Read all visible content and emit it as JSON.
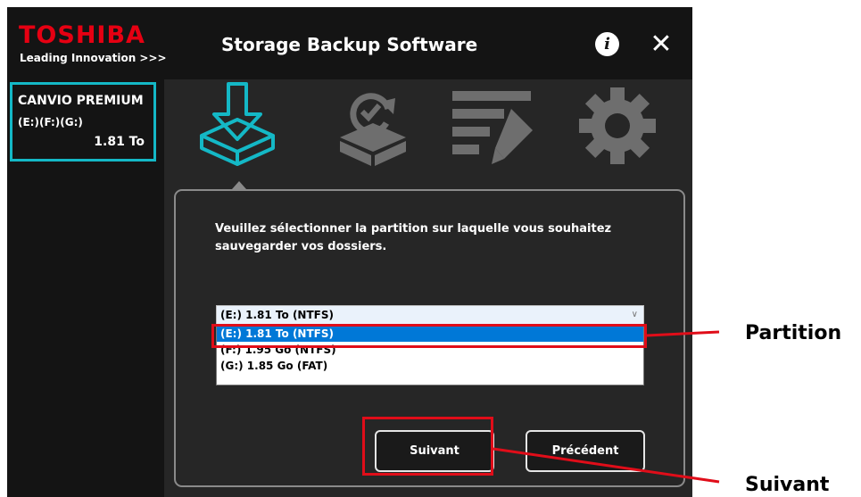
{
  "window": {
    "brand": "TOSHIBA",
    "tagline": "Leading Innovation >>>",
    "title": "Storage Backup Software",
    "info_glyph": "i",
    "close_glyph": "✕"
  },
  "sidebar": {
    "drive": {
      "name": "CANVIO PREMIUM",
      "letters": "(E:)(F:)(G:)",
      "size": "1.81 To"
    }
  },
  "tabs": [
    {
      "icon": "backup-download-icon",
      "active": true
    },
    {
      "icon": "restore-sync-icon",
      "active": false
    },
    {
      "icon": "edit-list-icon",
      "active": false
    },
    {
      "icon": "settings-gear-icon",
      "active": false
    }
  ],
  "dialog": {
    "prompt": "Veuillez sélectionner la partition sur laquelle vous souhaitez sauvegarder vos dossiers.",
    "select_value": "(E:) 1.81 To (NTFS)",
    "options": [
      "(E:) 1.81 To (NTFS)",
      "(F:) 1.95 Go (NTFS)",
      "(G:) 1.85 Go (FAT)"
    ],
    "selected_index": 0,
    "next_label": "Suivant",
    "prev_label": "Précédent"
  },
  "callouts": {
    "partition": "Partition",
    "next": "Suivant"
  },
  "colors": {
    "brand_red": "#e60012",
    "accent_cyan": "#14b8c6",
    "highlight_red": "#e00d19",
    "selection_blue": "#0078d7"
  }
}
